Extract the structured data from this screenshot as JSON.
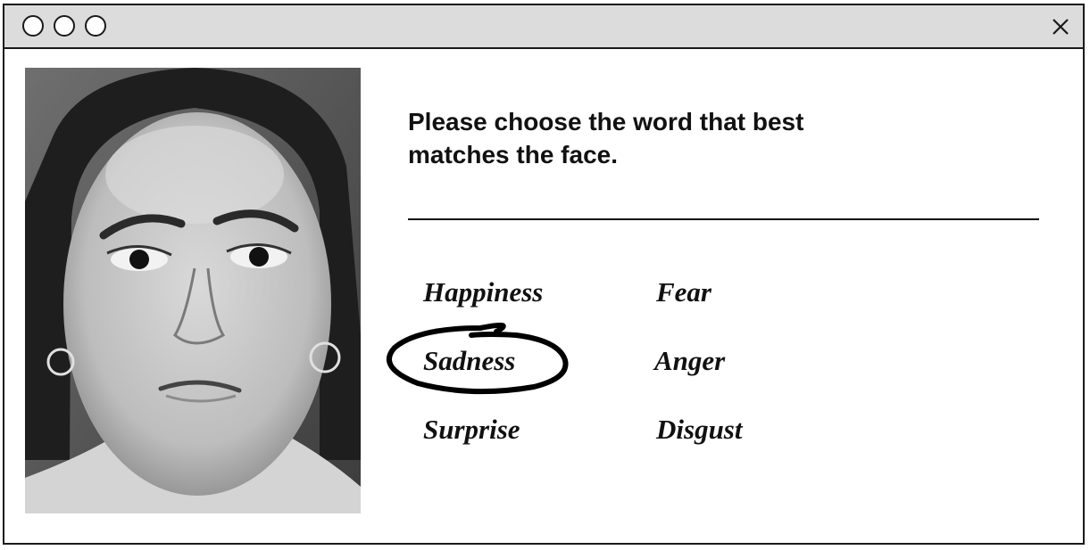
{
  "window": {
    "buttons": [
      "window-dot",
      "window-dot",
      "window-dot"
    ],
    "close_icon": "close-icon"
  },
  "prompt": {
    "line1": "Please choose the word that best",
    "line2": "matches the face."
  },
  "options": [
    {
      "label": "Happiness",
      "selected": false
    },
    {
      "label": "Fear",
      "selected": false
    },
    {
      "label": "Sadness",
      "selected": true
    },
    {
      "label": "Anger",
      "selected": false
    },
    {
      "label": "Surprise",
      "selected": false
    },
    {
      "label": "Disgust",
      "selected": false
    }
  ],
  "colors": {
    "titlebar": "#dcdcdc",
    "border": "#1a1a1a",
    "text": "#111111"
  }
}
